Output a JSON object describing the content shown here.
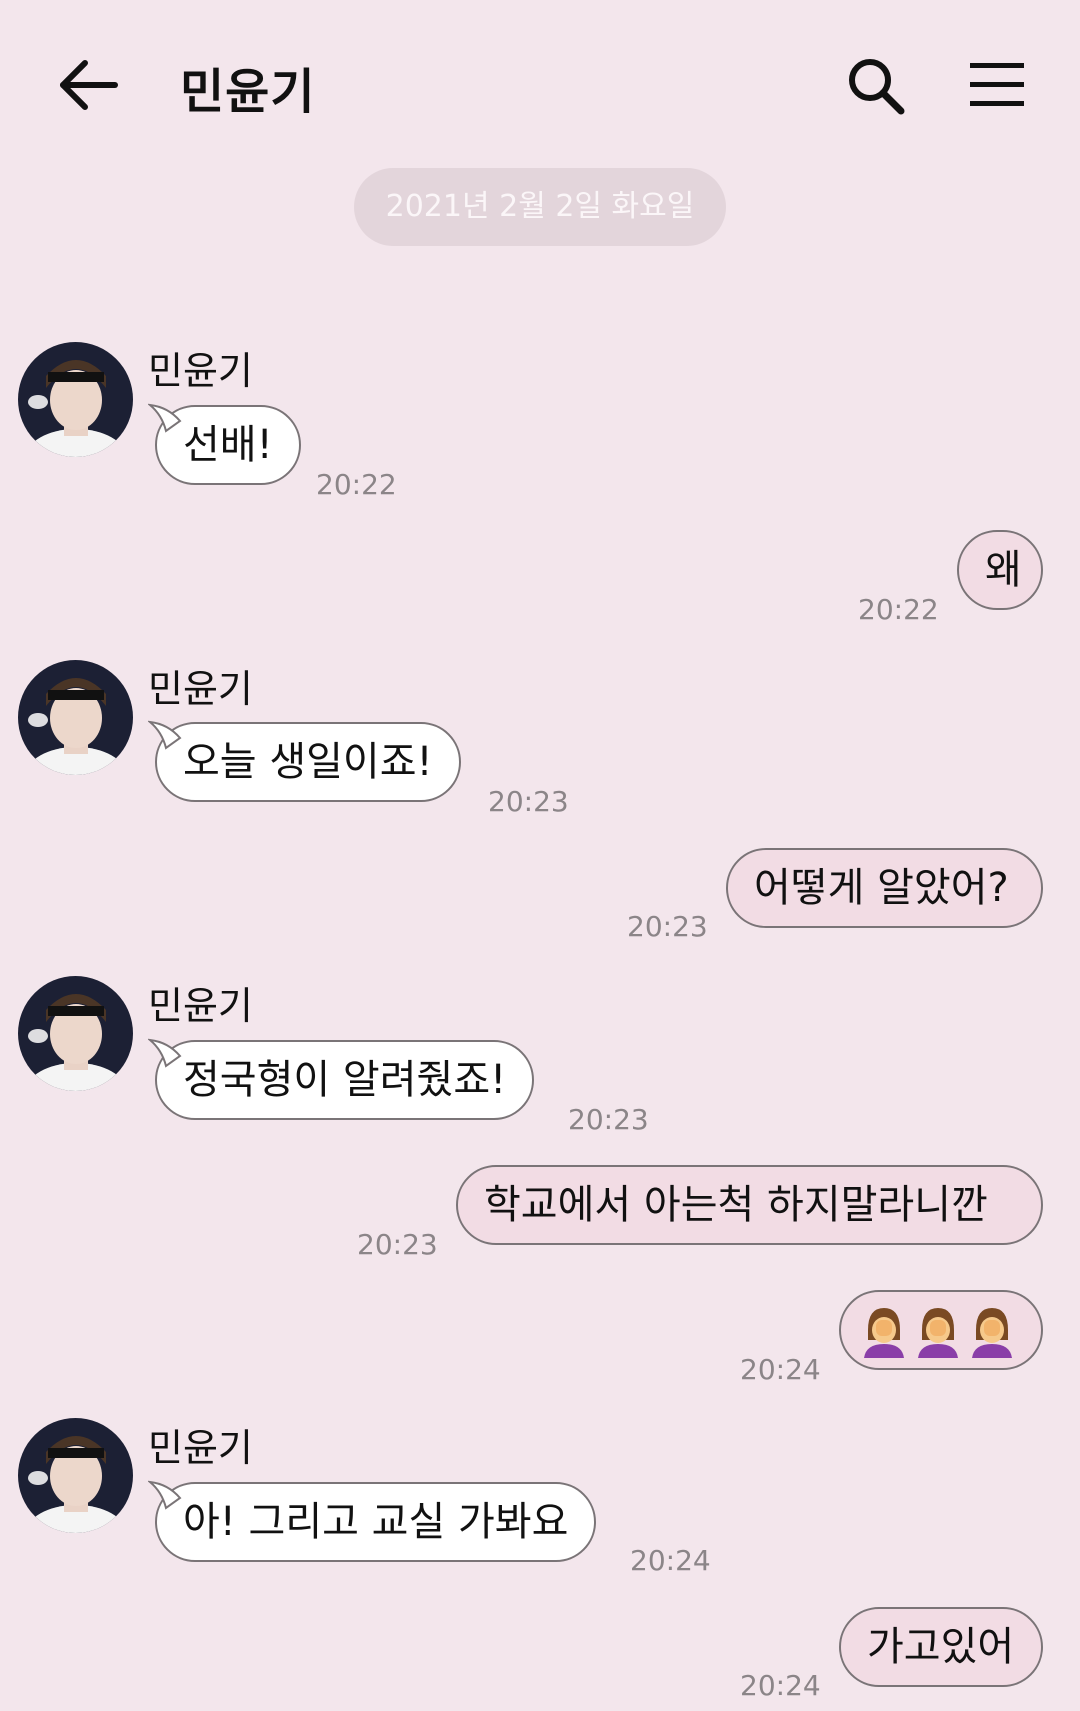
{
  "header": {
    "title": "민윤기",
    "back_icon": "arrow-left-icon",
    "search_icon": "search-icon",
    "menu_icon": "hamburger-menu-icon"
  },
  "date_separator": "2021년 2월 2일 화요일",
  "contact_name": "민윤기",
  "messages": [
    {
      "direction": "in",
      "sender": "민윤기",
      "text": "선배!",
      "time": "20:22"
    },
    {
      "direction": "out",
      "text": "왜",
      "time": "20:22"
    },
    {
      "direction": "in",
      "sender": "민윤기",
      "text": "오늘 생일이죠!",
      "time": "20:23"
    },
    {
      "direction": "out",
      "text": "어떻게 알았어?",
      "time": "20:23"
    },
    {
      "direction": "in",
      "sender": "민윤기",
      "text": "정국형이 알려줬죠!",
      "time": "20:23"
    },
    {
      "direction": "out",
      "text": "학교에서 아는척 하지말라니깐",
      "time": "20:23"
    },
    {
      "direction": "out",
      "text": "",
      "emoji": "facepalm-woman-emoji",
      "emoji_count": 3,
      "time": "20:24"
    },
    {
      "direction": "in",
      "sender": "민윤기",
      "text": "아! 그리고 교실 가봐요",
      "time": "20:24"
    },
    {
      "direction": "out",
      "text": "가고있어",
      "time": "20:24"
    }
  ],
  "colors": {
    "background": "#f3e6ec",
    "incoming_bubble": "#ffffff",
    "outgoing_bubble": "#f2dce4",
    "date_pill": "#e3d5db",
    "time_text": "#8b8588"
  }
}
